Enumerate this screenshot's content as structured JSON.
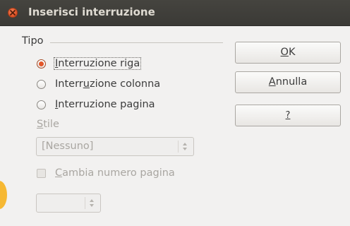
{
  "window": {
    "title": "Inserisci interruzione"
  },
  "type_group": {
    "label": "Tipo",
    "options": [
      {
        "pre": "",
        "u": "I",
        "post": "nterruzione riga",
        "checked": true
      },
      {
        "pre": "Interr",
        "u": "u",
        "post": "zione colonna",
        "checked": false
      },
      {
        "pre": "",
        "u": "I",
        "post": "nterruzione pagina",
        "checked": false
      }
    ]
  },
  "style": {
    "label_u": "S",
    "label_rest": "tile",
    "value": "[Nessuno]"
  },
  "page_number": {
    "checkbox_u": "C",
    "checkbox_rest": "ambia numero pagina",
    "checked": false,
    "value": ""
  },
  "buttons": {
    "ok_u": "O",
    "ok_rest": "K",
    "cancel_u": "A",
    "cancel_rest": "nnulla",
    "help_label": "?"
  },
  "colors": {
    "titlebar": "#3f3e3a",
    "accent": "#e2562a",
    "window_bg": "#f2f1f0"
  },
  "icons": {
    "close": "close-icon"
  }
}
